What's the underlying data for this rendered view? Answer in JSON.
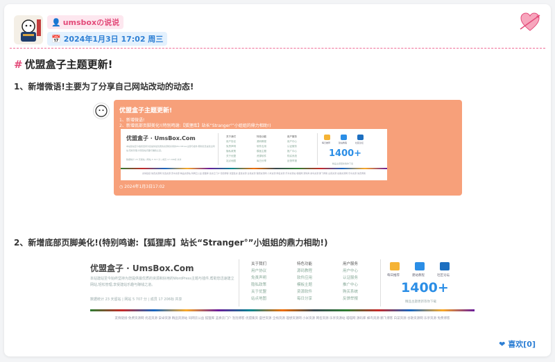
{
  "post": {
    "author": "umsboxの说说",
    "date": "2024年1月3日 17:02 周三",
    "title": "优盟盒子主题更新!",
    "line1": "1、新增微语!主要为了分享自己网站改动的动态!",
    "line2": "2、新增底部页脚美化!(特别鸣谢:【狐狸库】站长“Stranger°”小姐姐的鼎力相助!)",
    "like_label": "喜欢[0]"
  },
  "bubble": {
    "title": "优盟盒子主题更新!",
    "line1": "1、新增微语!",
    "line2": "2、新增底部页脚美化!(特别鸣谢:【狐狸库】站长“Stranger°”小姐姐的鼎力相助!)",
    "date": "2024年1月3日17:02"
  },
  "footer_mock": {
    "brand": "优盟盒子 · UmsBox.Com",
    "desc": "本站建站至今始终坚持为您提供最优质的资源和好用的WordPress主题与插件,帮助您迅速建立网站,轻松管理,享受建站乐趣与赚钱之道。",
    "stats": "数据统计 23 天留站 | 网站 5 707 分 | 成员 17 206标 共享",
    "columns": [
      {
        "title": "关于我们",
        "items": [
          "用户协议",
          "免责声明",
          "隐私政策",
          "关于优盟",
          "站点地图"
        ]
      },
      {
        "title": "特色功能",
        "items": [
          "源码教程",
          "软件应用",
          "模板主题",
          "资源软件",
          "每日分享"
        ]
      },
      {
        "title": "用户服务",
        "items": [
          "用户中心",
          "认证服务",
          "推广中心",
          "购买系统",
          "反馈举报"
        ]
      }
    ],
    "icons": [
      "每日推荐",
      "建站教程",
      "社区论坛"
    ],
    "big_number": "1400+",
    "big_caption": "精品主题更新等你下载",
    "links": "友情链接:免费资源网 优选资源 安卓资源 精品资源站 码网云公益 狐狸库 蓝奏云门户 泡泡博客 优盟集资 盛世资源 全栈资源 理想资源网 小米资源 网名资源 乐享资源站 喵喵网 源码库 蜂鸟资源 鹏飞博客 白菜资源 谷歌资源网 乐享资源 免费博客"
  },
  "colors": {
    "accent_pink": "#e34b7a",
    "accent_blue": "#2d7fd4",
    "bubble_orange": "#f7a07a"
  }
}
